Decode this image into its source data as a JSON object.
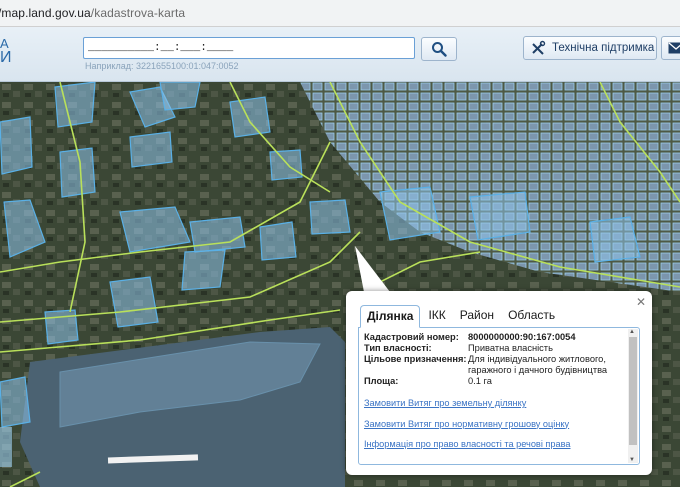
{
  "browser": {
    "url_prefix": "/map.land.gov.ua",
    "url_path": "/kadastrova-karta"
  },
  "header": {
    "logo_top": "А",
    "logo_bottom": "И",
    "search_value": "__________:__:___:____",
    "search_hint": "Наприклад: 3221655100:01:047:0052",
    "support_label": "Технічна підтримка"
  },
  "popup": {
    "tabs": [
      "Ділянка",
      "ІКК",
      "Район",
      "Область"
    ],
    "rows": [
      {
        "key": "Кадастровий номер:",
        "value": "8000000000:90:167:0054"
      },
      {
        "key": "Тип власності:",
        "value": "Приватна власність"
      },
      {
        "key": "Цільове призначення:",
        "value": "Для індивідуального житлового, гаражного і дачного будівництва"
      },
      {
        "key": "Площа:",
        "value": "0.1 га"
      }
    ],
    "links": [
      "Замовити Витяг про земельну ділянку",
      "Замовити Витяг про нормативну грошову оцінку",
      "Інформація про право власності та речові права"
    ]
  },
  "colors": {
    "parcel_fill": "#8ec3ea",
    "parcel_stroke": "#5ab0e6",
    "road_line": "#b9e05a",
    "link": "#3a73c4"
  },
  "icons": [
    "search-icon",
    "tools-icon",
    "mail-icon",
    "close-icon"
  ]
}
